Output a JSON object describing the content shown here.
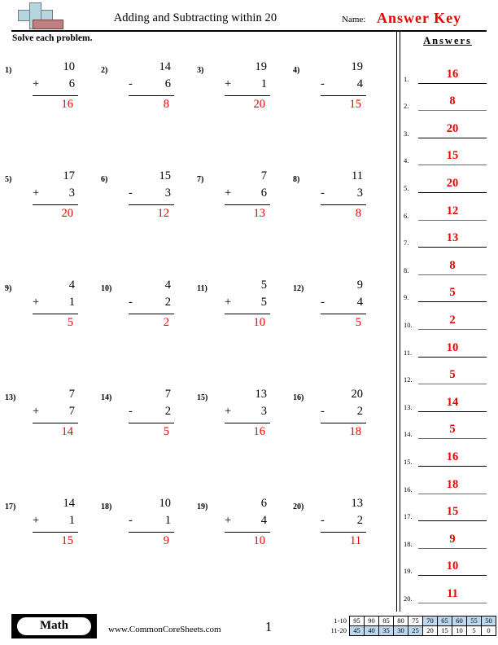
{
  "header": {
    "title": "Adding and Subtracting within 20",
    "name_label": "Name:",
    "answer_key": "Answer Key",
    "instruction": "Solve each problem.",
    "logo_plus_color": "#b5d6de",
    "logo_block_color": "#bf7f7f"
  },
  "colors": {
    "answer_red": "#ee0000",
    "scale_highlight": "#bdd7ee"
  },
  "problems": [
    {
      "num": "1)",
      "top": "10",
      "op": "+",
      "bottom": "6",
      "answer": "16"
    },
    {
      "num": "2)",
      "top": "14",
      "op": "-",
      "bottom": "6",
      "answer": "8"
    },
    {
      "num": "3)",
      "top": "19",
      "op": "+",
      "bottom": "1",
      "answer": "20"
    },
    {
      "num": "4)",
      "top": "19",
      "op": "-",
      "bottom": "4",
      "answer": "15"
    },
    {
      "num": "5)",
      "top": "17",
      "op": "+",
      "bottom": "3",
      "answer": "20"
    },
    {
      "num": "6)",
      "top": "15",
      "op": "-",
      "bottom": "3",
      "answer": "12"
    },
    {
      "num": "7)",
      "top": "7",
      "op": "+",
      "bottom": "6",
      "answer": "13"
    },
    {
      "num": "8)",
      "top": "11",
      "op": "-",
      "bottom": "3",
      "answer": "8"
    },
    {
      "num": "9)",
      "top": "4",
      "op": "+",
      "bottom": "1",
      "answer": "5"
    },
    {
      "num": "10)",
      "top": "4",
      "op": "-",
      "bottom": "2",
      "answer": "2"
    },
    {
      "num": "11)",
      "top": "5",
      "op": "+",
      "bottom": "5",
      "answer": "10"
    },
    {
      "num": "12)",
      "top": "9",
      "op": "-",
      "bottom": "4",
      "answer": "5"
    },
    {
      "num": "13)",
      "top": "7",
      "op": "+",
      "bottom": "7",
      "answer": "14"
    },
    {
      "num": "14)",
      "top": "7",
      "op": "-",
      "bottom": "2",
      "answer": "5"
    },
    {
      "num": "15)",
      "top": "13",
      "op": "+",
      "bottom": "3",
      "answer": "16"
    },
    {
      "num": "16)",
      "top": "20",
      "op": "-",
      "bottom": "2",
      "answer": "18"
    },
    {
      "num": "17)",
      "top": "14",
      "op": "+",
      "bottom": "1",
      "answer": "15"
    },
    {
      "num": "18)",
      "top": "10",
      "op": "-",
      "bottom": "1",
      "answer": "9"
    },
    {
      "num": "19)",
      "top": "6",
      "op": "+",
      "bottom": "4",
      "answer": "10"
    },
    {
      "num": "20)",
      "top": "13",
      "op": "-",
      "bottom": "2",
      "answer": "11"
    }
  ],
  "answers_panel": {
    "title": "Answers",
    "items": [
      {
        "index": "1.",
        "value": "16"
      },
      {
        "index": "2.",
        "value": "8"
      },
      {
        "index": "3.",
        "value": "20"
      },
      {
        "index": "4.",
        "value": "15"
      },
      {
        "index": "5.",
        "value": "20"
      },
      {
        "index": "6.",
        "value": "12"
      },
      {
        "index": "7.",
        "value": "13"
      },
      {
        "index": "8.",
        "value": "8"
      },
      {
        "index": "9.",
        "value": "5"
      },
      {
        "index": "10.",
        "value": "2"
      },
      {
        "index": "11.",
        "value": "10"
      },
      {
        "index": "12.",
        "value": "5"
      },
      {
        "index": "13.",
        "value": "14"
      },
      {
        "index": "14.",
        "value": "5"
      },
      {
        "index": "15.",
        "value": "16"
      },
      {
        "index": "16.",
        "value": "18"
      },
      {
        "index": "17.",
        "value": "15"
      },
      {
        "index": "18.",
        "value": "9"
      },
      {
        "index": "19.",
        "value": "10"
      },
      {
        "index": "20.",
        "value": "11"
      }
    ]
  },
  "footer": {
    "subject_badge": "Math",
    "site_url": "www.CommonCoreSheets.com",
    "page_number": "1",
    "scale": {
      "rows": [
        {
          "label": "1-10",
          "cells": [
            {
              "v": "95",
              "hl": false
            },
            {
              "v": "90",
              "hl": false
            },
            {
              "v": "85",
              "hl": false
            },
            {
              "v": "80",
              "hl": false
            },
            {
              "v": "75",
              "hl": false
            },
            {
              "v": "70",
              "hl": true
            },
            {
              "v": "65",
              "hl": true
            },
            {
              "v": "60",
              "hl": true
            },
            {
              "v": "55",
              "hl": true
            },
            {
              "v": "50",
              "hl": true
            }
          ]
        },
        {
          "label": "11-20",
          "cells": [
            {
              "v": "45",
              "hl": true
            },
            {
              "v": "40",
              "hl": true
            },
            {
              "v": "35",
              "hl": true
            },
            {
              "v": "30",
              "hl": true
            },
            {
              "v": "25",
              "hl": true
            },
            {
              "v": "20",
              "hl": false
            },
            {
              "v": "15",
              "hl": false
            },
            {
              "v": "10",
              "hl": false
            },
            {
              "v": "5",
              "hl": false
            },
            {
              "v": "0",
              "hl": false
            }
          ]
        }
      ]
    }
  }
}
